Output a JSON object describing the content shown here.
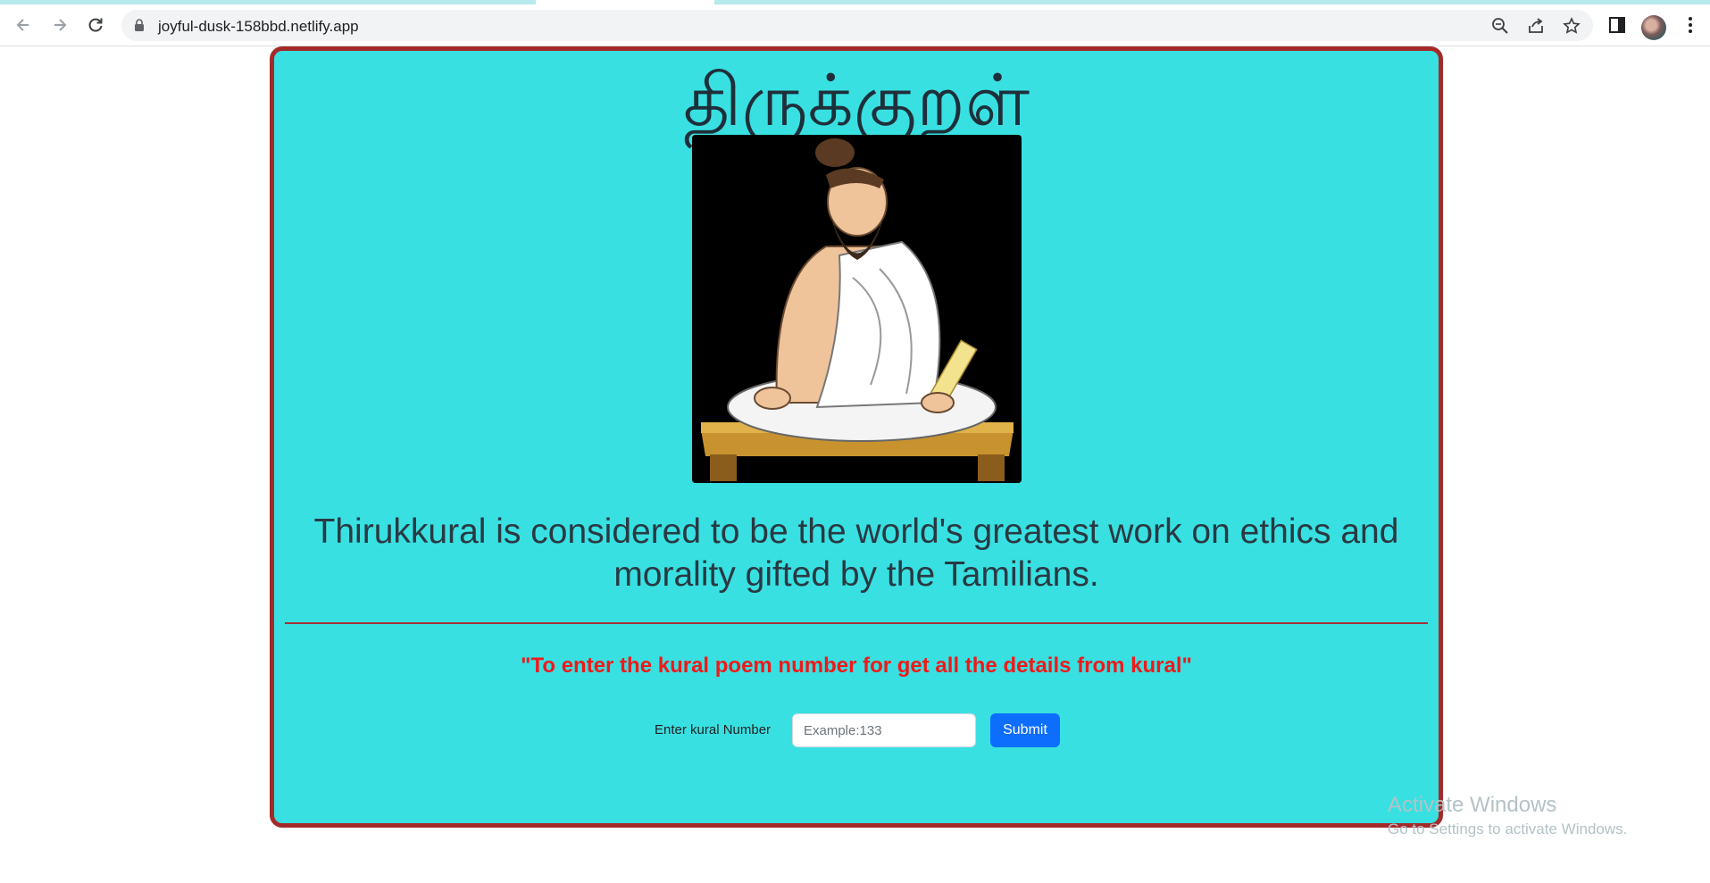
{
  "browser": {
    "url": "joyful-dusk-158bbd.netlify.app",
    "icons": [
      "back-icon",
      "forward-icon",
      "reload-icon",
      "lock-icon",
      "zoom-icon",
      "share-icon",
      "bookmark-star-icon",
      "side-panel-icon",
      "avatar",
      "menu-icon"
    ]
  },
  "page": {
    "title": "திருக்குறள்",
    "tagline": "Thirukkural is considered to be the world's greatest work on ethics and morality gifted by the Tamilians.",
    "instruction": "\"To enter the kural poem number for get all the details from kural\"",
    "form": {
      "label": "Enter kural Number",
      "input_placeholder": "Example:133",
      "input_value": "",
      "submit_label": "Submit"
    },
    "colors": {
      "background": "#38e0e2",
      "border": "#a42a2a",
      "instruction": "#f01919",
      "button": "#0d6efd"
    }
  },
  "watermark": {
    "title": "Activate Windows",
    "subtitle": "Go to Settings to activate Windows."
  }
}
